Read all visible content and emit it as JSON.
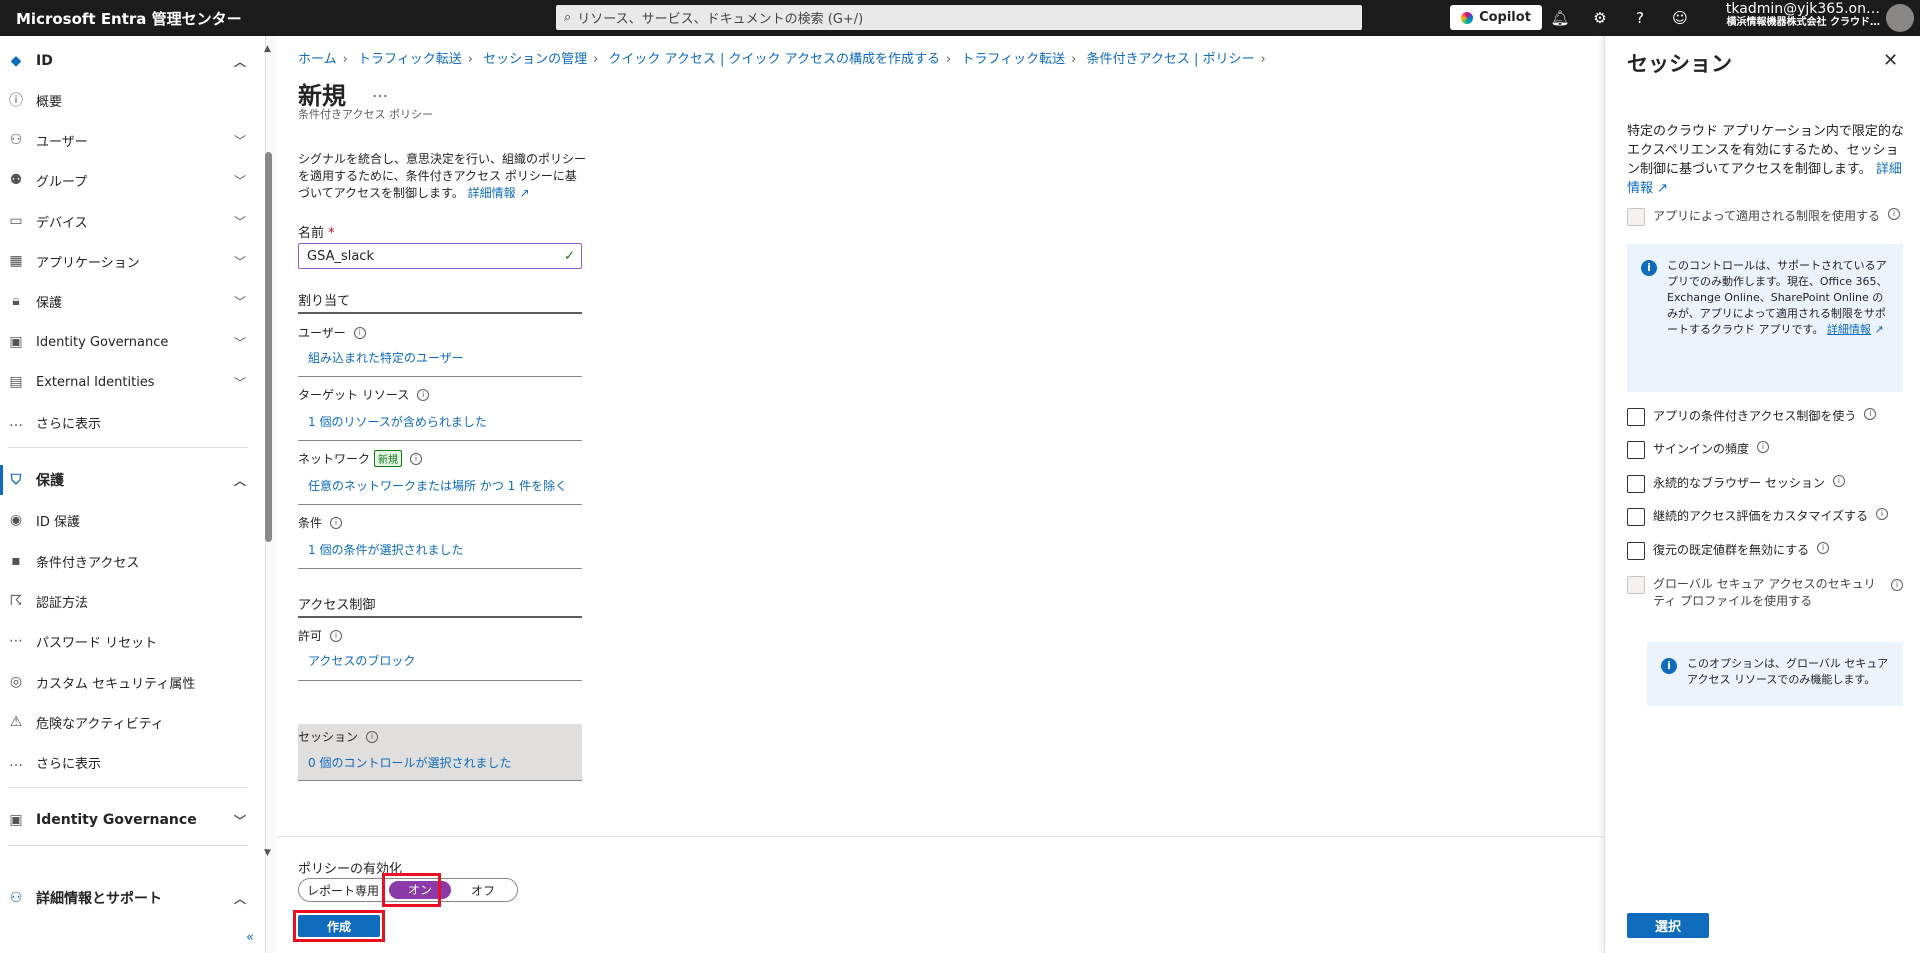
{
  "topbar": {
    "brand": "Microsoft Entra 管理センター",
    "search_placeholder": "リソース、サービス、ドキュメントの検索 (G+/)",
    "copilot": "Copilot",
    "account_name": "tkadmin@yjk365.on…",
    "account_org": "横浜情報機器株式会社  クラウド…"
  },
  "sidebar": {
    "items": [
      {
        "label": "ID",
        "icon": "diamond-icon"
      },
      {
        "label": "概要",
        "icon": "info-icon"
      },
      {
        "label": "ユーザー",
        "icon": "user-icon"
      },
      {
        "label": "グループ",
        "icon": "group-icon"
      },
      {
        "label": "デバイス",
        "icon": "device-icon"
      },
      {
        "label": "アプリケーション",
        "icon": "app-icon"
      },
      {
        "label": "保護",
        "icon": "lock-icon"
      },
      {
        "label": "Identity Governance",
        "icon": "governance-icon"
      },
      {
        "label": "External Identities",
        "icon": "external-icon"
      },
      {
        "label": "さらに表示",
        "icon": "ellipsis-icon"
      },
      {
        "label": "保護",
        "icon": "person-shield-icon"
      },
      {
        "label": "ID 保護",
        "icon": "id-protect-icon"
      },
      {
        "label": "条件付きアクセス",
        "icon": "conditional-icon"
      },
      {
        "label": "認証方法",
        "icon": "fingerprint-icon"
      },
      {
        "label": "パスワード リセット",
        "icon": "password-icon"
      },
      {
        "label": "カスタム セキュリティ属性",
        "icon": "attribute-icon"
      },
      {
        "label": "危険なアクティビティ",
        "icon": "risky-icon"
      },
      {
        "label": "さらに表示",
        "icon": "ellipsis-icon"
      },
      {
        "label": "Identity Governance",
        "icon": "governance-icon"
      },
      {
        "label": "詳細情報とサポート",
        "icon": "support-icon"
      }
    ]
  },
  "breadcrumb": [
    "ホーム",
    "トラフィック転送",
    "セッションの管理",
    "クイック アクセス | クイック アクセスの構成を作成する",
    "トラフィック転送",
    "条件付きアクセス | ポリシー"
  ],
  "page": {
    "title": "新規",
    "more": "…",
    "subtitle": "条件付きアクセス ポリシー",
    "description": "シグナルを統合し、意思決定を行い、組織のポリシーを適用するために、条件付きアクセス ポリシーに基づいてアクセスを制御します。",
    "learn_more": "詳細情報",
    "name_label": "名前",
    "name_required": "*",
    "name_value": "GSA_slack",
    "assignments_head": "割り当て",
    "users_label": "ユーザー",
    "users_value": "組み込まれた特定のユーザー",
    "target_label": "ターゲット リソース",
    "target_value": "1 個のリソースが含められました",
    "network_label": "ネットワーク",
    "network_badge": "新規",
    "network_value": "任意のネットワークまたは場所 かつ 1 件を除く",
    "conditions_label": "条件",
    "conditions_value": "1 個の条件が選択されました",
    "access_head": "アクセス制御",
    "grant_label": "許可",
    "grant_value": "アクセスのブロック",
    "session_label": "セッション",
    "session_value": "0 個のコントロールが選択されました",
    "enable_label": "ポリシーの有効化",
    "toggle_report": "レポート専用",
    "toggle_on": "オン",
    "toggle_off": "オフ",
    "create": "作成"
  },
  "panel": {
    "title": "セッション",
    "description": "特定のクラウド アプリケーション内で限定的なエクスペリエンスを有効にするため、セッション制御に基づいてアクセスを制御します。",
    "learn_more": "詳細情報",
    "opt_app_enforced": "アプリによって適用される制限を使用する",
    "info1": "このコントロールは、サポートされているアプリでのみ動作します。現在、Office 365、Exchange Online、SharePoint Online のみが、アプリによって適用される制限をサポートするクラウド アプリです。",
    "info1_link": "詳細情報",
    "opt_ca_app": "アプリの条件付きアクセス制御を使う",
    "opt_signin": "サインインの頻度",
    "opt_persistent": "永続的なブラウザー セッション",
    "opt_cae": "継続的アクセス評価をカスタマイズする",
    "opt_resilience": "復元の既定値群を無効にする",
    "opt_gsa": "グローバル セキュア アクセスのセキュリティ プロファイルを使用する",
    "info2": "このオプションは、グローバル セキュア アクセス リソースでのみ機能します。",
    "select": "選択"
  }
}
